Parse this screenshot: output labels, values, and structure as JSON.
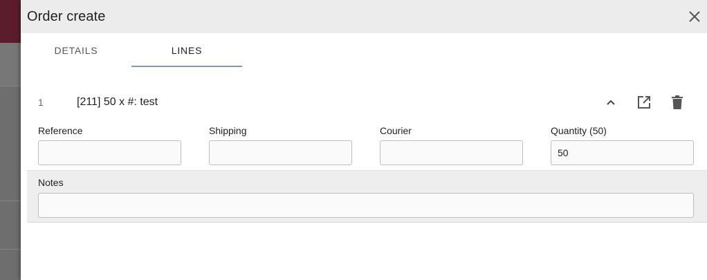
{
  "dialog": {
    "title": "Order create",
    "close_icon": "close-icon"
  },
  "tabs": [
    {
      "label": "DETAILS",
      "active": false
    },
    {
      "label": "LINES",
      "active": true
    }
  ],
  "line": {
    "number": "1",
    "title": "[211] 50 x #: test",
    "actions": [
      "chevron-up-icon",
      "open-in-new-icon",
      "delete-icon"
    ]
  },
  "fields": {
    "reference": {
      "label": "Reference",
      "value": ""
    },
    "shipping": {
      "label": "Shipping",
      "value": ""
    },
    "courier": {
      "label": "Courier",
      "value": ""
    },
    "quantity": {
      "label": "Quantity (50)",
      "value": "50"
    },
    "notes": {
      "label": "Notes",
      "value": ""
    }
  },
  "colors": {
    "header_bg": "#ececec",
    "tab_indicator": "#7f9ab8",
    "brand": "#5b1d2b"
  }
}
